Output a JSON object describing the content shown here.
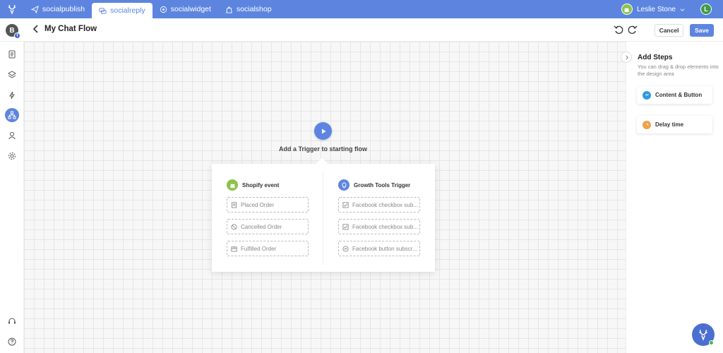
{
  "nav": {
    "tabs": [
      {
        "label": "socialpublish",
        "icon": "paper-plane-icon"
      },
      {
        "label": "socialreply",
        "icon": "chat-bubbles-icon"
      },
      {
        "label": "socialwidget",
        "icon": "widget-icon"
      },
      {
        "label": "socialshop",
        "icon": "shopping-bag-icon"
      }
    ],
    "active_tab": "socialreply",
    "user_name": "Leslie Stone",
    "user_avatar_letter": "L"
  },
  "header": {
    "account_letter": "B",
    "title": "My Chat Flow",
    "cancel_label": "Cancel",
    "save_label": "Save"
  },
  "canvas": {
    "trigger_label": "Add a Trigger to starting flow",
    "shopify": {
      "title": "Shopify event",
      "options": [
        "Placed Order",
        "Cancelled Order",
        "Fulfilled Order"
      ]
    },
    "growth": {
      "title": "Growth Tools Trigger",
      "options": [
        "Facebook checkbox sub...",
        "Facebook checkbox sub...",
        "Facebook button subscr..."
      ]
    }
  },
  "right_panel": {
    "title": "Add Steps",
    "subtitle": "You can drag & drop elements into the design area",
    "steps": [
      {
        "label": "Content & Button",
        "icon": "messenger-icon"
      },
      {
        "label": "Delay time",
        "icon": "clock-icon"
      }
    ]
  },
  "colors": {
    "primary": "#5d85e0",
    "shopify_green": "#8bc34a",
    "delay_orange": "#f0a04b",
    "messenger_blue": "#2f9ae0"
  }
}
